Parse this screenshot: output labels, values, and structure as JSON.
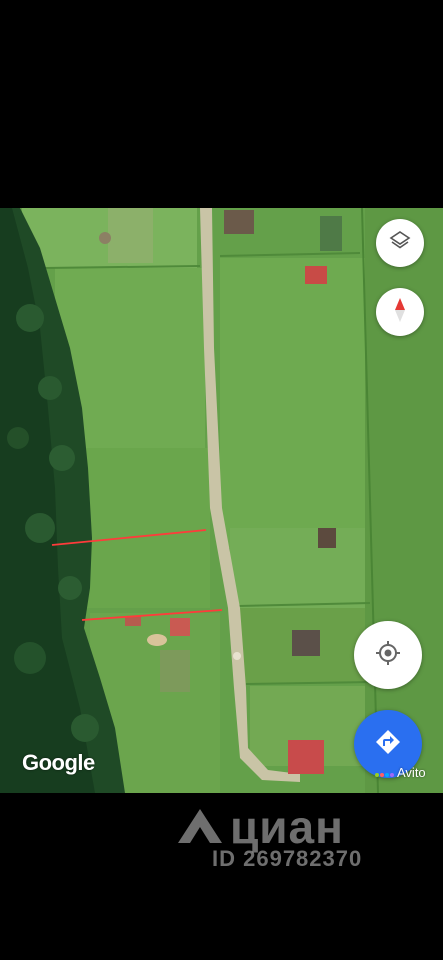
{
  "map": {
    "attribution": "Google",
    "source_badge": "Avito",
    "badge_dot_colors": [
      "#97cf26",
      "#ff6163",
      "#0af",
      "#a169f7"
    ]
  },
  "controls": [
    {
      "id": "layers",
      "icon": "layers-icon"
    },
    {
      "id": "compass",
      "icon": "compass-icon"
    },
    {
      "id": "my-location",
      "icon": "my-location-icon"
    },
    {
      "id": "directions",
      "icon": "directions-icon"
    }
  ],
  "watermark": {
    "brand": "циан",
    "listing_id": "ID 269782370"
  },
  "colors": {
    "control_blue": "#2a6ff0",
    "compass_red": "#e53935",
    "plot_line": "#ff3b3b"
  }
}
